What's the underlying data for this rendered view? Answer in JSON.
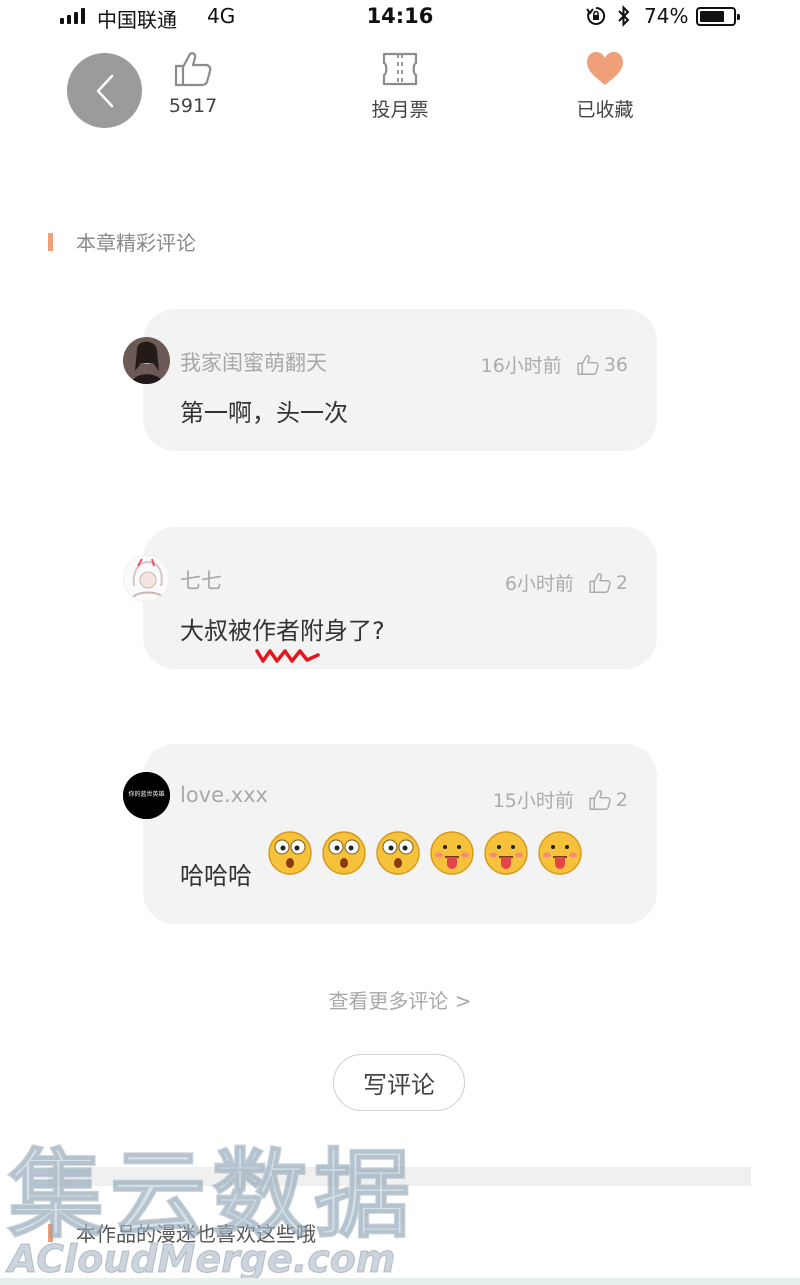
{
  "status_bar": {
    "carrier": "中国联通",
    "network": "4G",
    "time": "14:16",
    "battery": "74%",
    "battery_level": 0.74
  },
  "actions": {
    "like_count": "5917",
    "vote_label": "投月票",
    "favorite_label": "已收藏"
  },
  "accent_color": "#f0a079",
  "comments_section": {
    "title": "本章精彩评论",
    "comments": [
      {
        "user": "我家闺蜜萌翻天",
        "time": "16小时前",
        "likes": "36",
        "text": "第一啊，头一次"
      },
      {
        "user": "七七",
        "time": "6小时前",
        "likes": "2",
        "text": "大叔被作者附身了?"
      },
      {
        "user": "love.xxx",
        "time": "15小时前",
        "likes": "2",
        "text": "哈哈哈",
        "emojis": [
          "shocked-face",
          "shocked-face",
          "shocked-face",
          "tongue-face",
          "tongue-face",
          "tongue-face"
        ],
        "avatar_text": "你的蓝世英雄"
      }
    ],
    "more_label": "查看更多评论 >",
    "write_label": "写评论"
  },
  "related_section": {
    "title": "本作品的漫迷也喜欢这些哦"
  },
  "watermark": {
    "line1": "集云数据",
    "line2": "ACloudMerge.com"
  }
}
